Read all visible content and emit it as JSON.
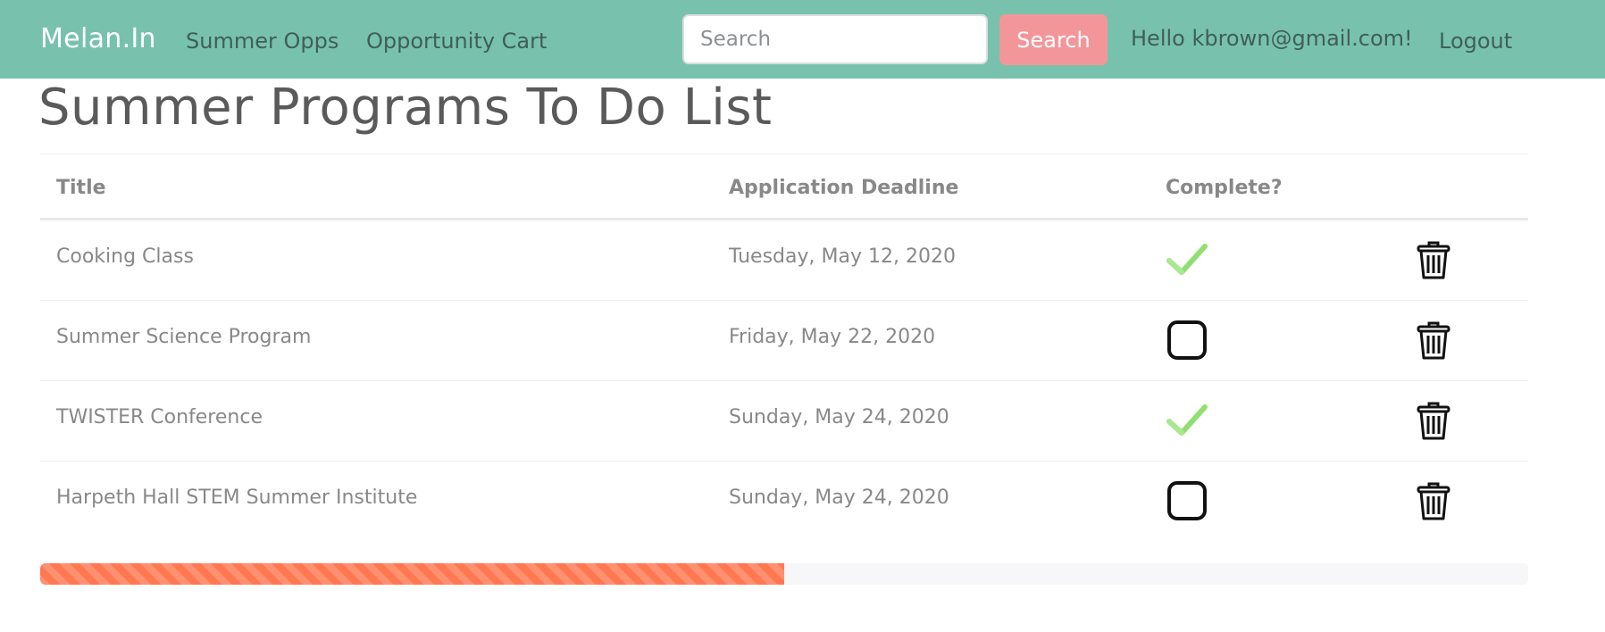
{
  "navbar": {
    "brand": "Melan.In",
    "links": [
      "Summer Opps",
      "Opportunity Cart"
    ],
    "search_placeholder": "Search",
    "search_value": "",
    "search_button": "Search",
    "greeting": "Hello kbrown@gmail.com!",
    "logout": "Logout",
    "color": "#78c2ad",
    "search_button_color": "#f3969a"
  },
  "page": {
    "title": "Summer Programs To Do List"
  },
  "table": {
    "columns": [
      "Title",
      "Application Deadline",
      "Complete?"
    ],
    "rows": [
      {
        "title": "Cooking Class",
        "deadline": "Tuesday, May 12, 2020",
        "complete": true
      },
      {
        "title": "Summer Science Program",
        "deadline": "Friday, May 22, 2020",
        "complete": false
      },
      {
        "title": "TWISTER Conference",
        "deadline": "Sunday, May 24, 2020",
        "complete": true
      },
      {
        "title": "Harpeth Hall STEM Summer Institute",
        "deadline": "Sunday, May 24, 2020",
        "complete": false
      }
    ],
    "icons": {
      "complete": "check-icon",
      "incomplete": "checkbox-icon",
      "delete": "trash-icon"
    }
  },
  "progress": {
    "percent": 50,
    "color": "#ff7851"
  }
}
